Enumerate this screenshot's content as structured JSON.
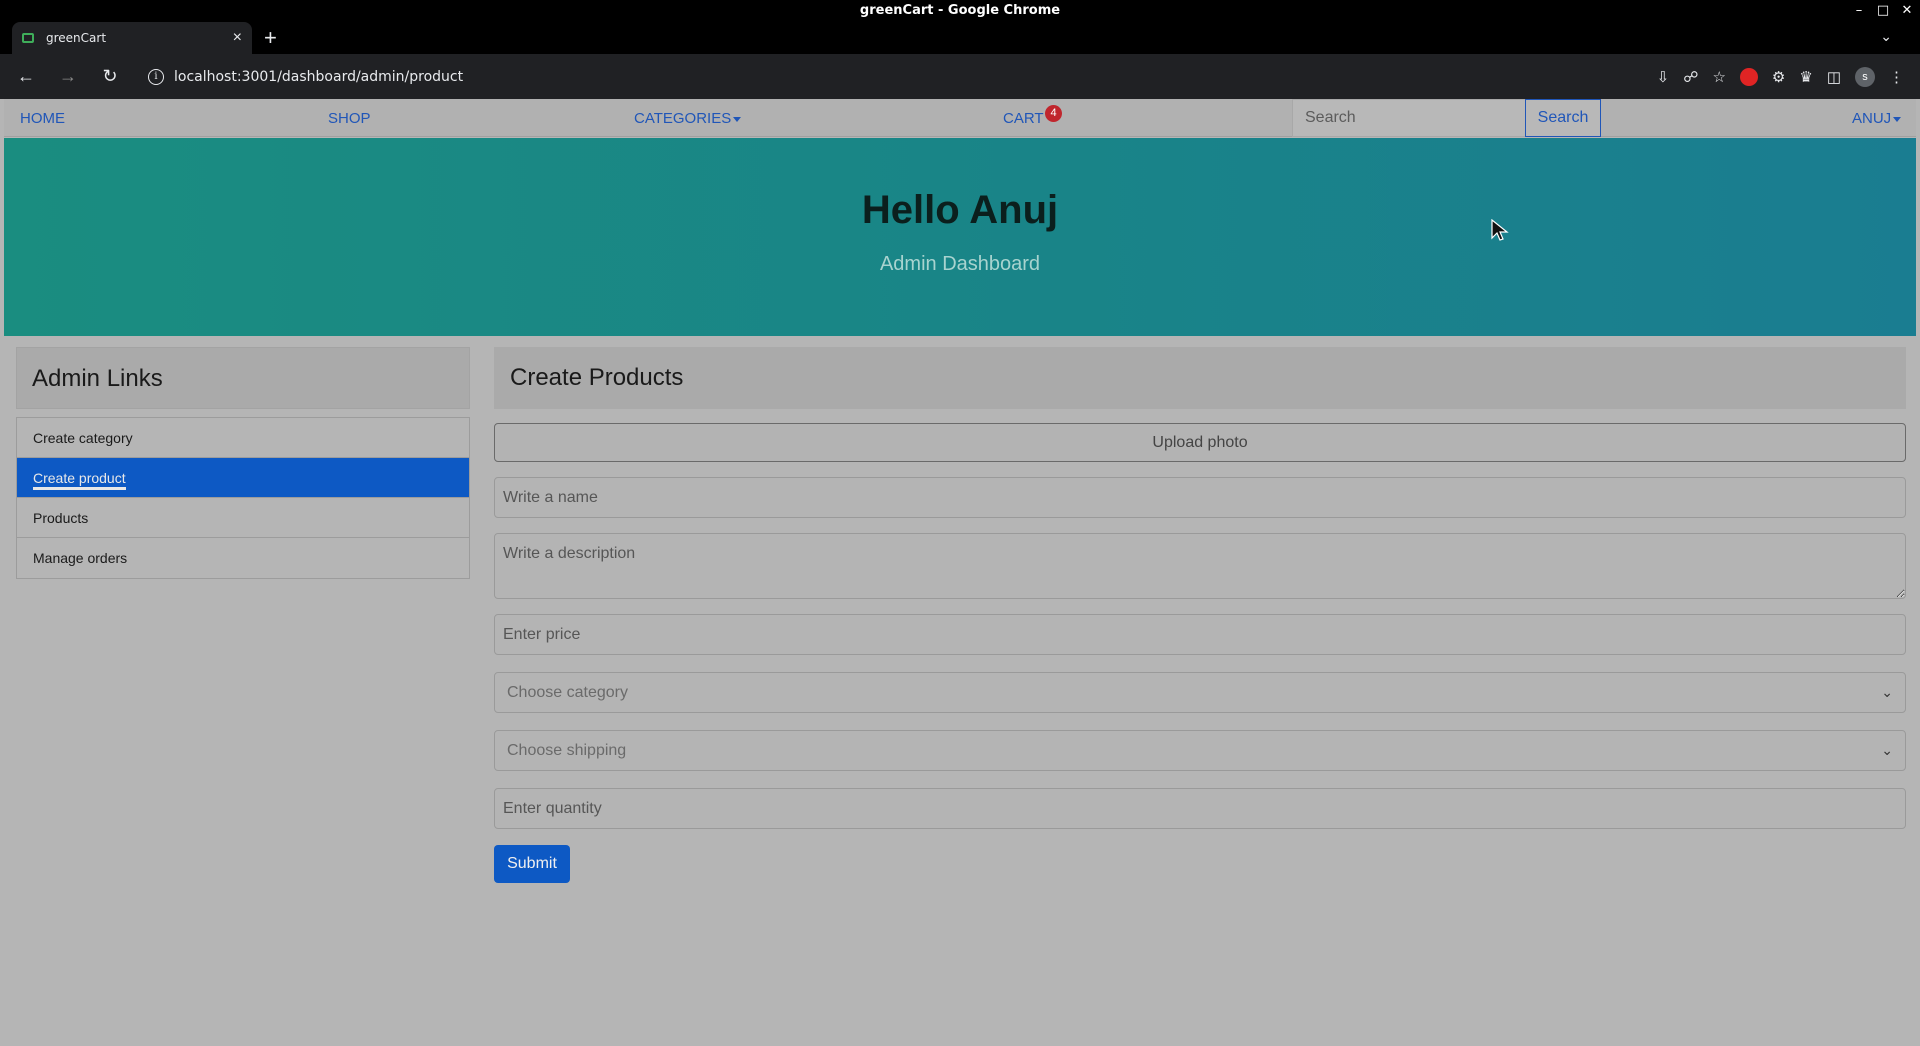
{
  "window": {
    "title": "greenCart - Google Chrome"
  },
  "browser": {
    "tab_title": "greenCart",
    "url": "localhost:3001/dashboard/admin/product",
    "profile_initial": "s"
  },
  "nav": {
    "home": "HOME",
    "shop": "SHOP",
    "categories": "CATEGORIES",
    "cart": "CART",
    "cart_count": "4",
    "search_placeholder": "Search",
    "search_button": "Search",
    "user": "ANUJ"
  },
  "hero": {
    "title": "Hello Anuj",
    "subtitle": "Admin Dashboard"
  },
  "sidebar": {
    "heading": "Admin Links",
    "items": [
      {
        "label": "Create category"
      },
      {
        "label": "Create product"
      },
      {
        "label": "Products"
      },
      {
        "label": "Manage orders"
      }
    ]
  },
  "form": {
    "heading": "Create Products",
    "upload_label": "Upload photo",
    "name_placeholder": "Write a name",
    "description_placeholder": "Write a description",
    "price_placeholder": "Enter price",
    "category_placeholder": "Choose category",
    "shipping_placeholder": "Choose shipping",
    "quantity_placeholder": "Enter quantity",
    "submit_label": "Submit"
  }
}
